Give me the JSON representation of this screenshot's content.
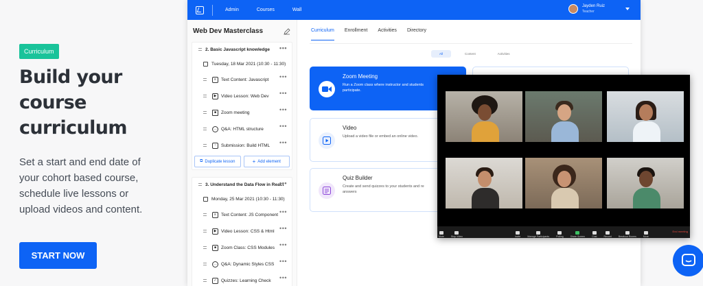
{
  "hero": {
    "tag": "Curriculum",
    "headline": "Build your course curriculum",
    "description": "Set a start and end date of your cohort based course, schedule live lessons or upload videos and content.",
    "cta": "START NOW"
  },
  "topbar": {
    "nav": [
      "Admin",
      "Courses",
      "Wall"
    ],
    "user_name": "Jayden Ruiz",
    "user_role": "Teacher"
  },
  "sidebar": {
    "course_title": "Web Dev Masterclass",
    "sections": [
      {
        "title": "2. Basic Javascript knowledge",
        "date": "Tuesday, 18 Mar 2021 (10:30 - 11:30)",
        "items": [
          "Text Content: Javascript",
          "Video Lesson: Web Dev",
          "Zoom meeting",
          "Q&A: HTML structure",
          "Submission: Build HTML"
        ],
        "duplicate_label": "Duplicate lesson",
        "add_label": "Add element"
      },
      {
        "title": "3. Understand the Data Flow in React",
        "date": "Monday, 25 Mar 2021 (10:30 - 11:30)",
        "items": [
          "Text Content: JS Component",
          "Video Lesson: CSS & Html",
          "Zoom Class: CSS Modules",
          "Q&A: Dynamic Styles CSS",
          "Quizzes: Learning Check"
        ]
      }
    ]
  },
  "main": {
    "tabs": [
      "Curriculum",
      "Enrollment",
      "Activities",
      "Directory"
    ],
    "pills": [
      "All",
      "Content",
      "Activities"
    ],
    "cards": [
      {
        "title": "Zoom Meeting",
        "desc": "Run a Zoom class where instructor and students participate."
      },
      {
        "title": "Video",
        "desc": "Upload a video file or embed an online video."
      },
      {
        "title": "Quiz Builder",
        "desc": "Create and send quizzes to your students and re answers"
      }
    ]
  },
  "call": {
    "toolbar": [
      "Mute",
      "Stop Video",
      "Invite",
      "Manage Participants",
      "Polling",
      "Share Screen",
      "Chat",
      "Record",
      "Breakout Rooms",
      "More"
    ],
    "participants_count": "24",
    "end_label": "End meeting"
  },
  "colors": {
    "accent": "#0d63f5",
    "tag": "#19c39a"
  },
  "icons": {
    "chat": "chat-bubble-icon",
    "edit": "pencil-icon"
  }
}
